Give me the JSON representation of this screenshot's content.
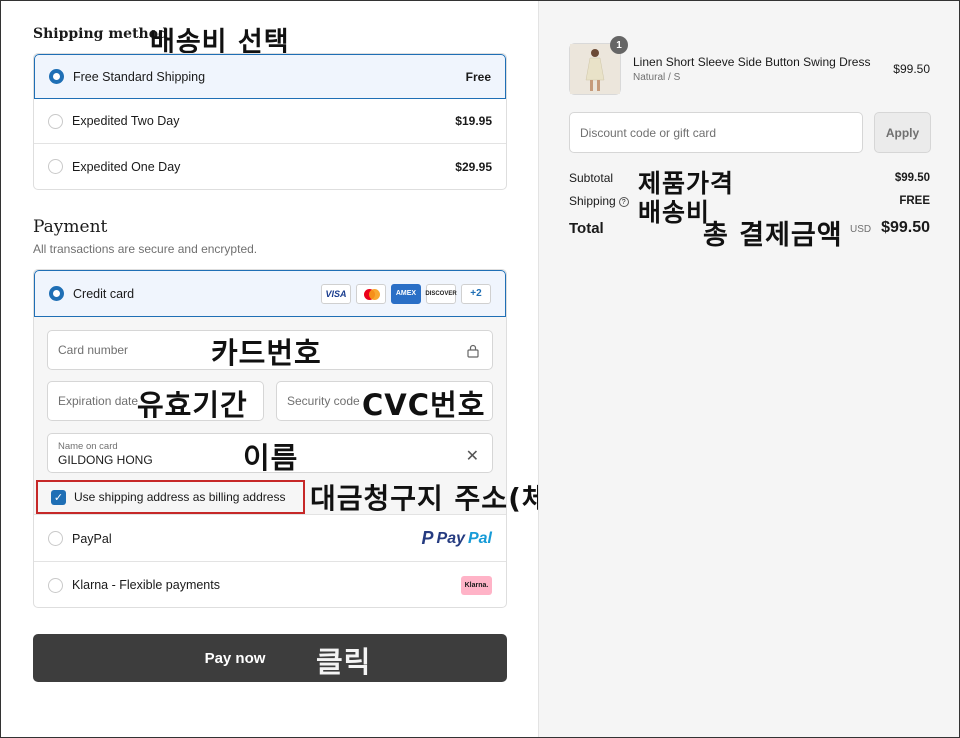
{
  "shipping": {
    "title": "Shipping method",
    "annotation": "배송비 선택",
    "options": [
      {
        "label": "Free Standard Shipping",
        "price": "Free",
        "selected": true
      },
      {
        "label": "Expedited Two Day",
        "price": "$19.95",
        "selected": false
      },
      {
        "label": "Expedited One Day",
        "price": "$29.95",
        "selected": false
      }
    ]
  },
  "payment": {
    "title": "Payment",
    "subtitle": "All transactions are secure and encrypted.",
    "credit_card_label": "Credit card",
    "card_brands": [
      "VISA",
      "AMEX",
      "DISCOVER"
    ],
    "more_cards": "+2",
    "card_number_placeholder": "Card number",
    "expiration_placeholder": "Expiration date",
    "security_placeholder": "Security code",
    "name_label": "Name on card",
    "name_value": "GILDONG HONG",
    "billing_checkbox": "Use shipping address as billing address",
    "paypal_label": "PayPal",
    "paypal_logo_a": "Pay",
    "paypal_logo_b": "Pal",
    "klarna_label": "Klarna - Flexible payments",
    "klarna_logo": "Klarna.",
    "pay_button": "Pay now",
    "annotations": {
      "card_number": "카드번호",
      "expiration": "유효기간",
      "security": "CVC번호",
      "name": "이름",
      "billing": "대금청구지 주소(체크o)",
      "pay": "클릭"
    }
  },
  "summary": {
    "item_name": "Linen Short Sleeve Side Button Swing Dress",
    "item_variant": "Natural / S",
    "item_price": "$99.50",
    "item_qty": "1",
    "discount_placeholder": "Discount code or gift card",
    "apply_label": "Apply",
    "subtotal_label": "Subtotal",
    "subtotal_value": "$99.50",
    "shipping_label": "Shipping",
    "shipping_value": "FREE",
    "total_label": "Total",
    "currency": "USD",
    "total_value": "$99.50",
    "annotations": {
      "subtotal": "제품가격",
      "shipping": "배송비",
      "total": "총 결제금액"
    }
  },
  "colors": {
    "accent": "#1f6fb5",
    "selected_bg": "#f0f5fd",
    "pay_button": "#3d3d3d",
    "highlight_border": "#c62828"
  }
}
